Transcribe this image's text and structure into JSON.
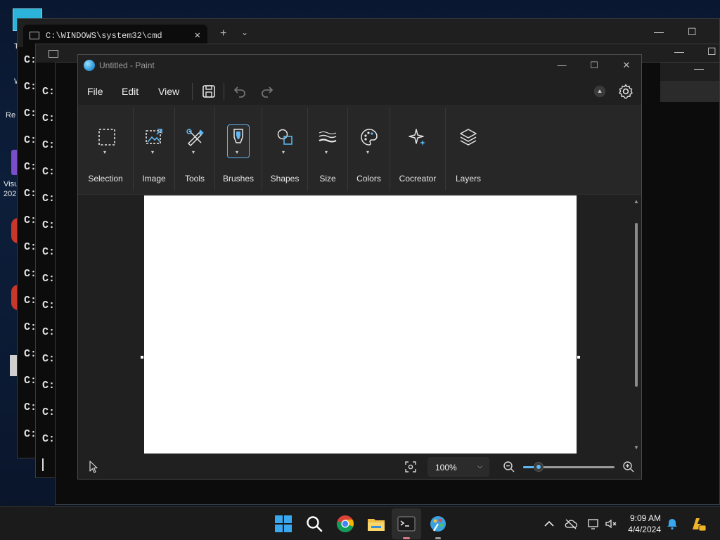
{
  "desktop": {
    "icon_labels": [
      "T",
      "W",
      "Re",
      "Visu",
      "202"
    ]
  },
  "cmd_window": {
    "tab_title": "C:\\WINDOWS\\system32\\cmd",
    "tab_close": "✕",
    "new_tab": "+",
    "tab_dropdown": "⌄",
    "minimize": "—",
    "maximize": "☐",
    "prompt": "C:"
  },
  "paint": {
    "title": "Untitled - Paint",
    "window_controls": {
      "minimize": "—",
      "maximize": "☐",
      "close": "✕"
    },
    "menu": {
      "file": "File",
      "edit": "Edit",
      "view": "View"
    },
    "ribbon": [
      {
        "label": "Selection",
        "icon": "selection-icon"
      },
      {
        "label": "Image",
        "icon": "image-icon"
      },
      {
        "label": "Tools",
        "icon": "tools-icon"
      },
      {
        "label": "Brushes",
        "icon": "brush-icon"
      },
      {
        "label": "Shapes",
        "icon": "shapes-icon"
      },
      {
        "label": "Size",
        "icon": "size-icon"
      },
      {
        "label": "Colors",
        "icon": "palette-icon"
      },
      {
        "label": "Cocreator",
        "icon": "sparkle-icon"
      },
      {
        "label": "Layers",
        "icon": "layers-icon"
      }
    ],
    "zoom": {
      "value": "100%",
      "slider_percent": 17
    },
    "accent": "#5fb8f4"
  },
  "taskbar": {
    "time": "9:09 AM",
    "date": "4/4/2024",
    "apps": [
      "start-icon",
      "search-icon",
      "chrome-icon",
      "file-explorer-icon",
      "terminal-icon",
      "paint-icon"
    ]
  }
}
